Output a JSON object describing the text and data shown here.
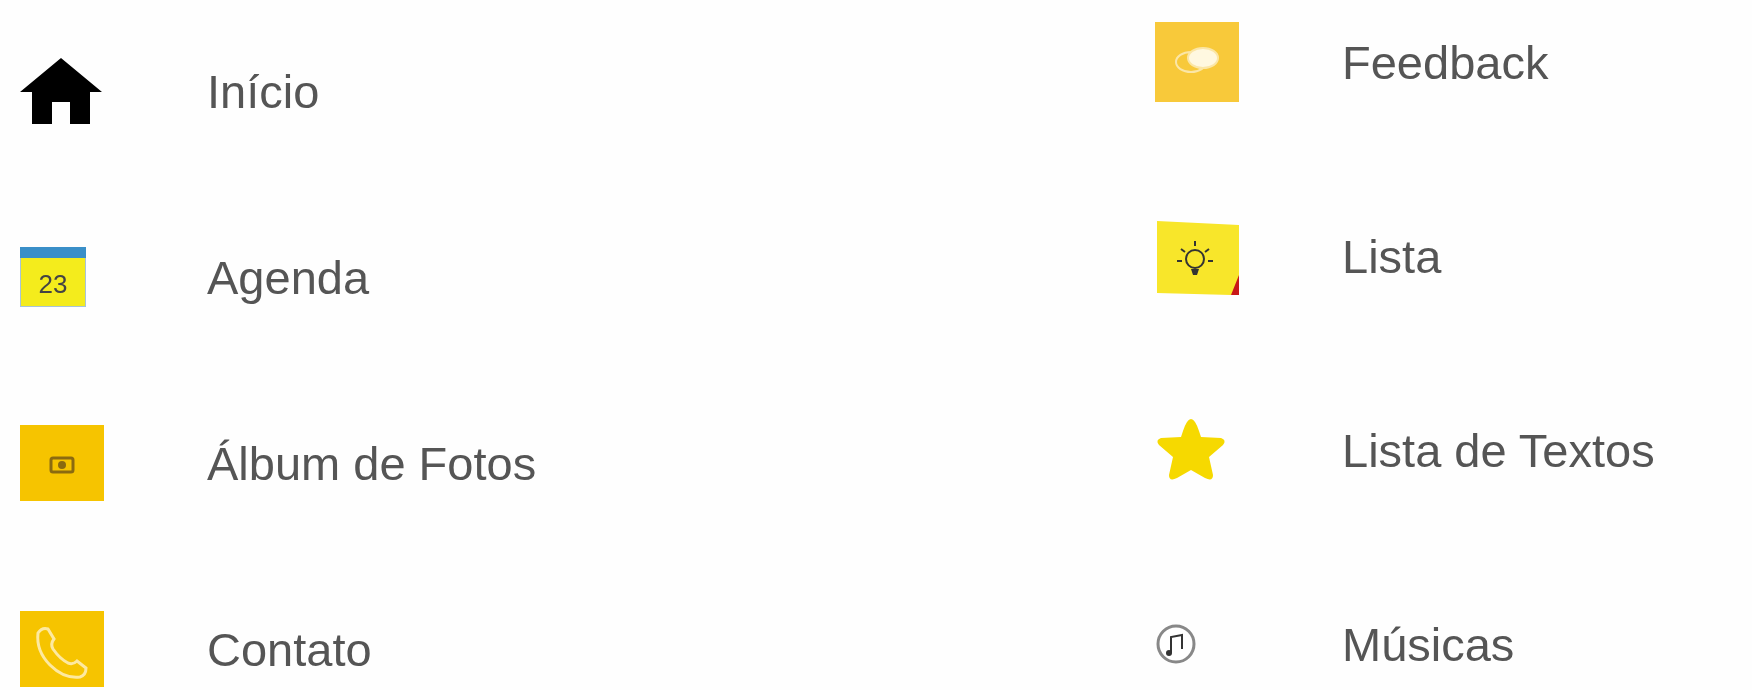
{
  "menu": {
    "columns": [
      {
        "items": [
          {
            "kind": "home",
            "label": "Início"
          },
          {
            "kind": "calendar",
            "label": "Agenda",
            "icon_text": "23"
          },
          {
            "kind": "camera",
            "label": "Álbum de Fotos"
          },
          {
            "kind": "phone",
            "label": "Contato"
          }
        ]
      },
      {
        "items": [
          {
            "kind": "chat",
            "label": "Feedback"
          },
          {
            "kind": "note",
            "label": "Lista"
          },
          {
            "kind": "star",
            "label": "Lista de Textos"
          },
          {
            "kind": "music",
            "label": "Músicas"
          }
        ]
      }
    ]
  }
}
